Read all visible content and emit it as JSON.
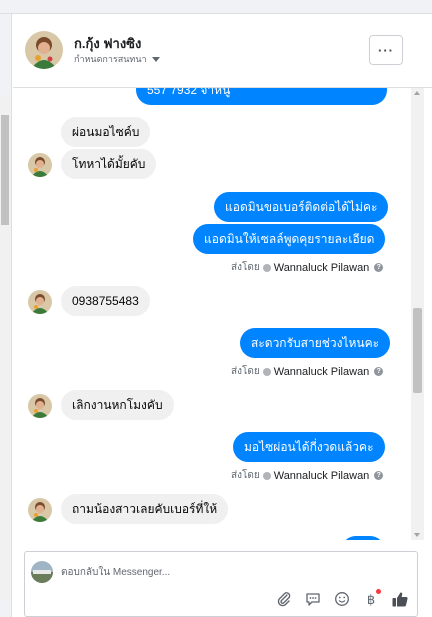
{
  "header": {
    "contact_name": "ก.กุ้ง ฟางซิง",
    "assign_label": "กำหนดการสนทนา",
    "more_label": "···"
  },
  "messages": {
    "m0": "557 7932 จ้าหนู",
    "m1": "ผ่อนมอไซค์บ",
    "m2": "โทหาได้มั้ยคับ",
    "m3": "แอดมินขอเบอร์ติดต่อได้ไม่คะ",
    "m4": "แอดมินให้เซลล์พูดคุยรายละเอียด",
    "m5": "0938755483",
    "m6": "สะดวกรับสายช่วงไหนคะ",
    "m7": "เลิกงานหกโมงคับ",
    "m8": "มอไซผ่อนได้กี่งวดแล้วคะ",
    "m9": "ถามน้องสาวเลยคับเบอร์ที่ให้"
  },
  "sent_by": {
    "prefix": "ส่งโดย",
    "name": "Wannaluck Pilawan"
  },
  "composer": {
    "placeholder": "ตอบกลับใน Messenger..."
  },
  "icons": [
    "more-icon",
    "chevron-down-icon",
    "attach-icon",
    "chat-icon",
    "emoji-icon",
    "currency-icon",
    "thumbs-up-icon",
    "help-icon"
  ],
  "colors": {
    "outgoing_bubble": "#0084ff",
    "incoming_bubble": "#f0f0f0",
    "notification_dot": "#fa383e"
  }
}
